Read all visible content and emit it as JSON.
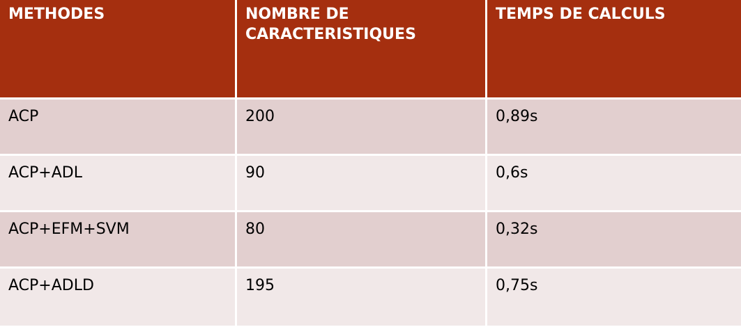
{
  "table": {
    "headers": [
      "METHODES",
      "NOMBRE DE CARACTERISTIQUES",
      "TEMPS DE CALCULS"
    ],
    "rows": [
      [
        "ACP",
        "200",
        "0,89s"
      ],
      [
        "ACP+ADL",
        "90",
        "0,6s"
      ],
      [
        "ACP+EFM+SVM",
        "80",
        "0,32s"
      ],
      [
        "ACP+ADLD",
        "195",
        "0,75s"
      ]
    ]
  },
  "colors": {
    "header_bg": "#a52f0f",
    "row_odd_bg": "#e2cfcf",
    "row_even_bg": "#f1e8e8"
  }
}
